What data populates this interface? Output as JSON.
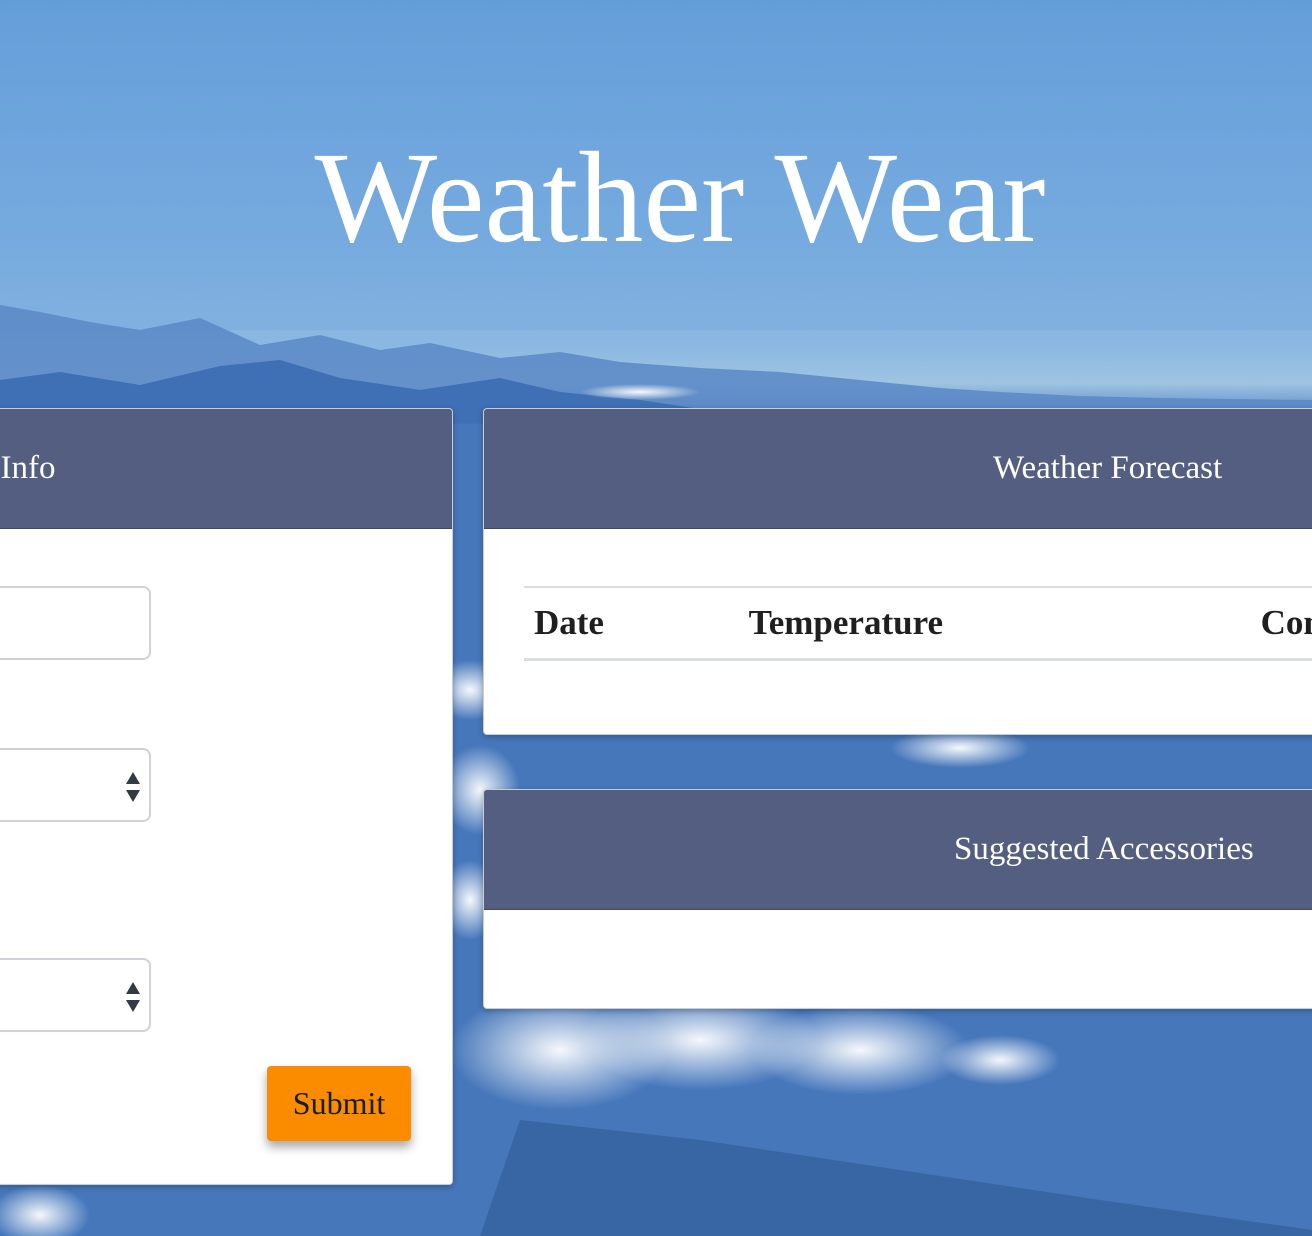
{
  "header": {
    "title": "Weather Wear"
  },
  "user_panel": {
    "title": "User Info",
    "submit_label": "Submit"
  },
  "forecast": {
    "title": "Weather Forecast",
    "columns": [
      "Date",
      "Temperature",
      "Conditions"
    ]
  },
  "accessories": {
    "title": "Suggested Accessories"
  },
  "colors": {
    "header_bg": "#535e80",
    "submit_bg": "#fb8c00"
  }
}
